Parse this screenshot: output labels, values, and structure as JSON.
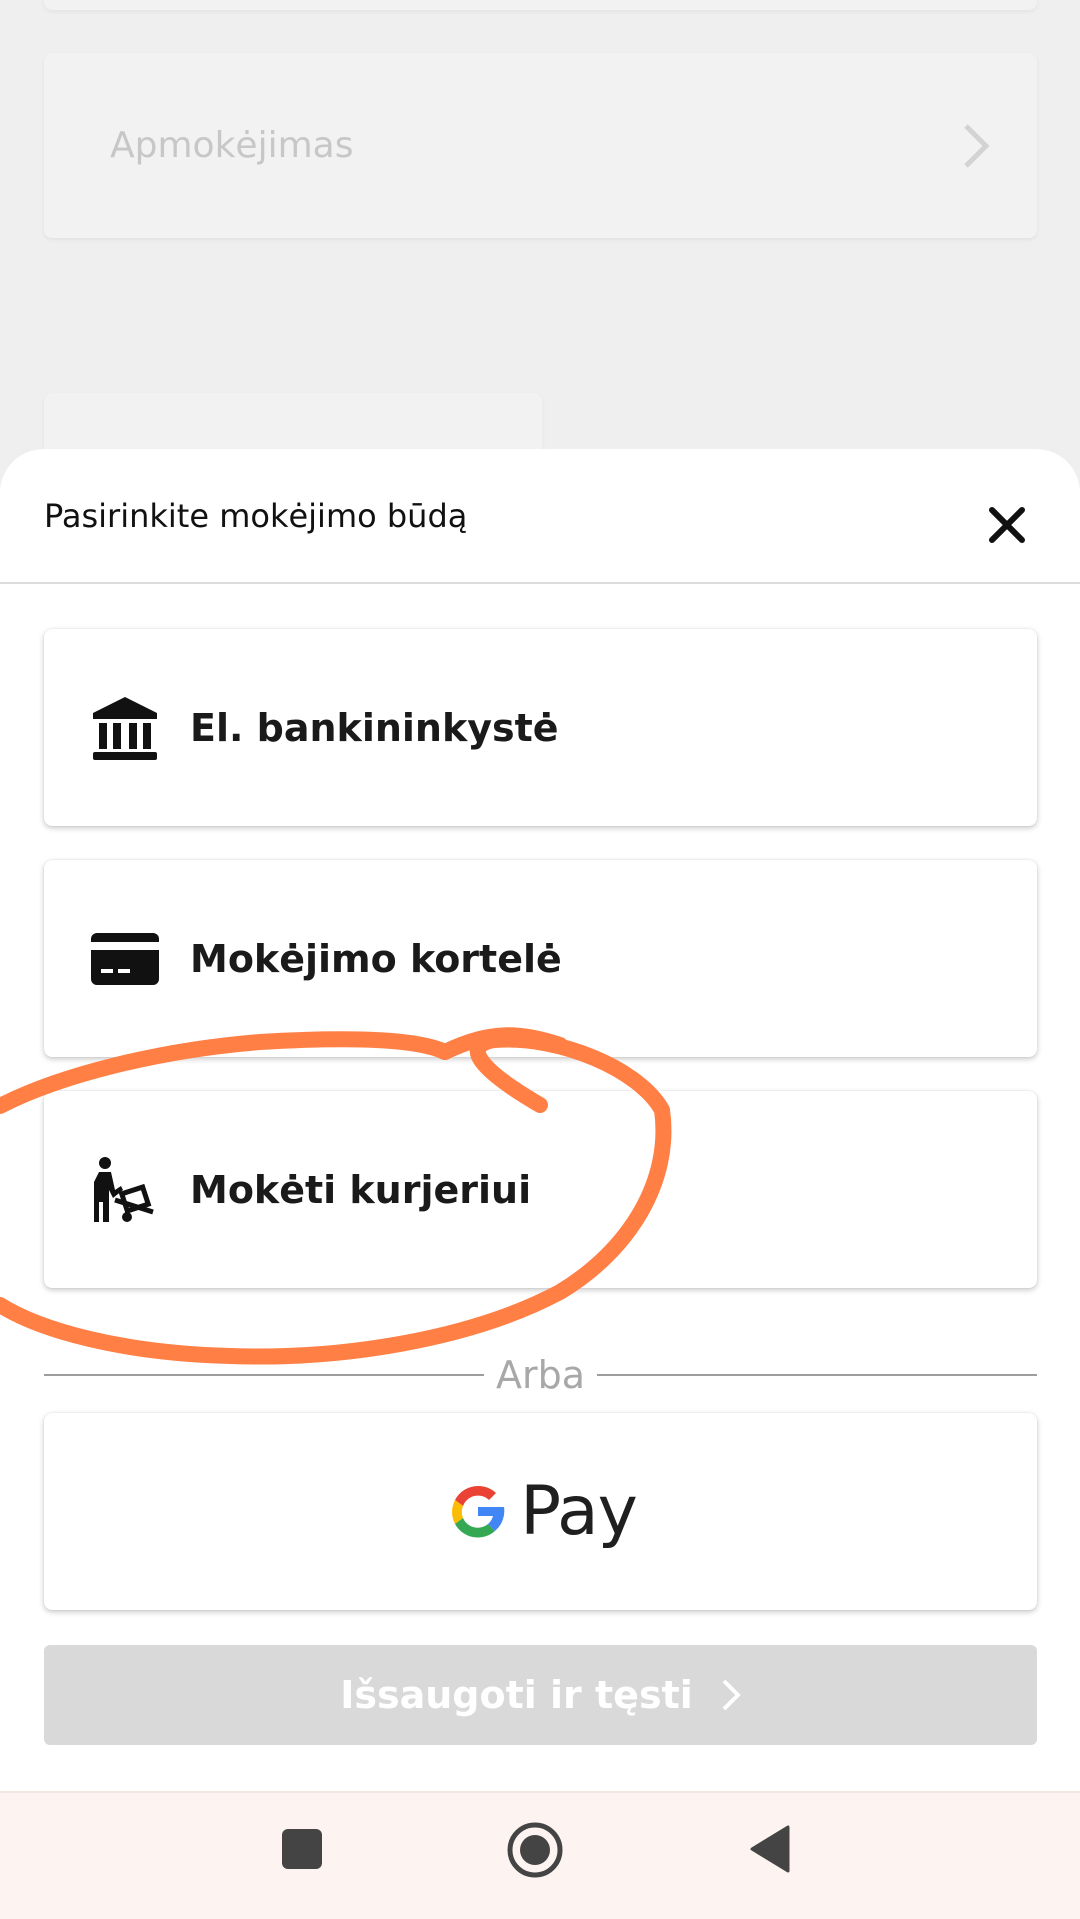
{
  "background": {
    "payment_row_label": "Apmokėjimas"
  },
  "sheet": {
    "title": "Pasirinkite mokėjimo būdą",
    "close_icon": "close-icon",
    "options": [
      {
        "label": "El. bankininkystė",
        "icon": "bank-icon"
      },
      {
        "label": "Mokėjimo kortelė",
        "icon": "credit-card-icon"
      },
      {
        "label": "Mokėti kurjeriui",
        "icon": "courier-dolly-icon"
      }
    ],
    "divider_text": "Arba",
    "gpay": {
      "pay_text": "Pay",
      "icon": "google-g-icon"
    },
    "save_button": {
      "label": "Išsaugoti ir tęsti",
      "enabled": false
    }
  },
  "navbar": {
    "recents_icon": "square-recents-icon",
    "home_icon": "circle-home-icon",
    "back_icon": "triangle-back-icon"
  },
  "annotation": {
    "type": "hand-drawn circle",
    "color": "#ff7f45",
    "target": "Mokėti kurjeriui"
  },
  "colors": {
    "sheet_background": "#ffffff",
    "page_background": "#efefef",
    "disabled_button": "#d9d9d9",
    "navbar_background": "#fdf4f1"
  }
}
